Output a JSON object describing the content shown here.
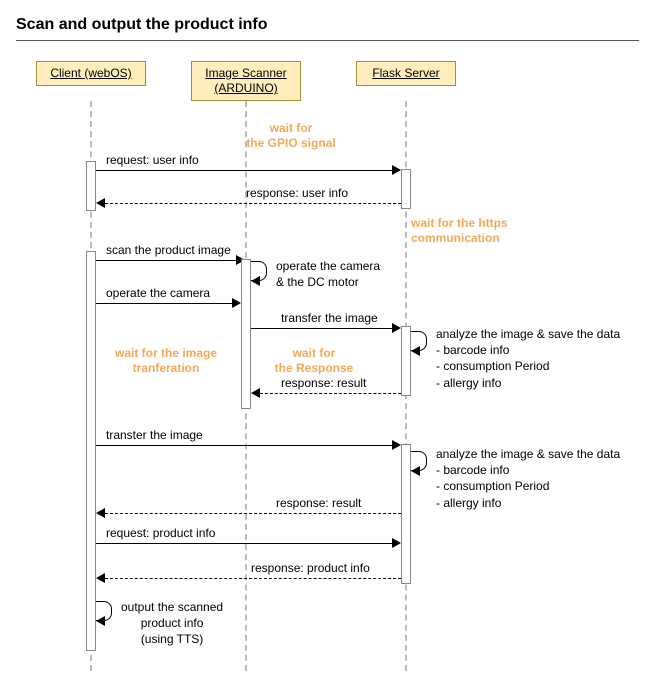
{
  "title": "Scan and output the product info",
  "lifelines": {
    "client": "Client (webOS)",
    "scanner_line1": "Image Scanner",
    "scanner_line2": "(ARDUINO)",
    "server": "Flask Server"
  },
  "notes": {
    "gpio_l1": "wait for",
    "gpio_l2": "the GPIO signal",
    "https_l1": "wait for the https",
    "https_l2": "communication",
    "imgxfer_l1": "wait for the image",
    "imgxfer_l2": "tranferation",
    "resp_l1": "wait for",
    "resp_l2": "the Response"
  },
  "messages": {
    "m1": "request: user info",
    "m2": "response: user info",
    "m3": "scan the product image",
    "m4": "operate the camera",
    "m5": "transfer the image",
    "m6": "response: result",
    "m7": "transter the image",
    "m8": "response: result",
    "m9": "request: product info",
    "m10": "response: product info"
  },
  "selfmsg": {
    "s1_l1": "operate the camera",
    "s1_l2": "& the DC motor",
    "s2_l1": "analyze the image & save the data",
    "s2_l2": "- barcode info",
    "s2_l3": "- consumption Period",
    "s2_l4": "- allergy info",
    "s3_l1": "analyze the image & save the data",
    "s3_l2": "- barcode info",
    "s3_l3": "- consumption Period",
    "s3_l4": "- allergy info",
    "out_l1": "output the scanned",
    "out_l2": "product  info",
    "out_l3": "(using TTS)"
  }
}
